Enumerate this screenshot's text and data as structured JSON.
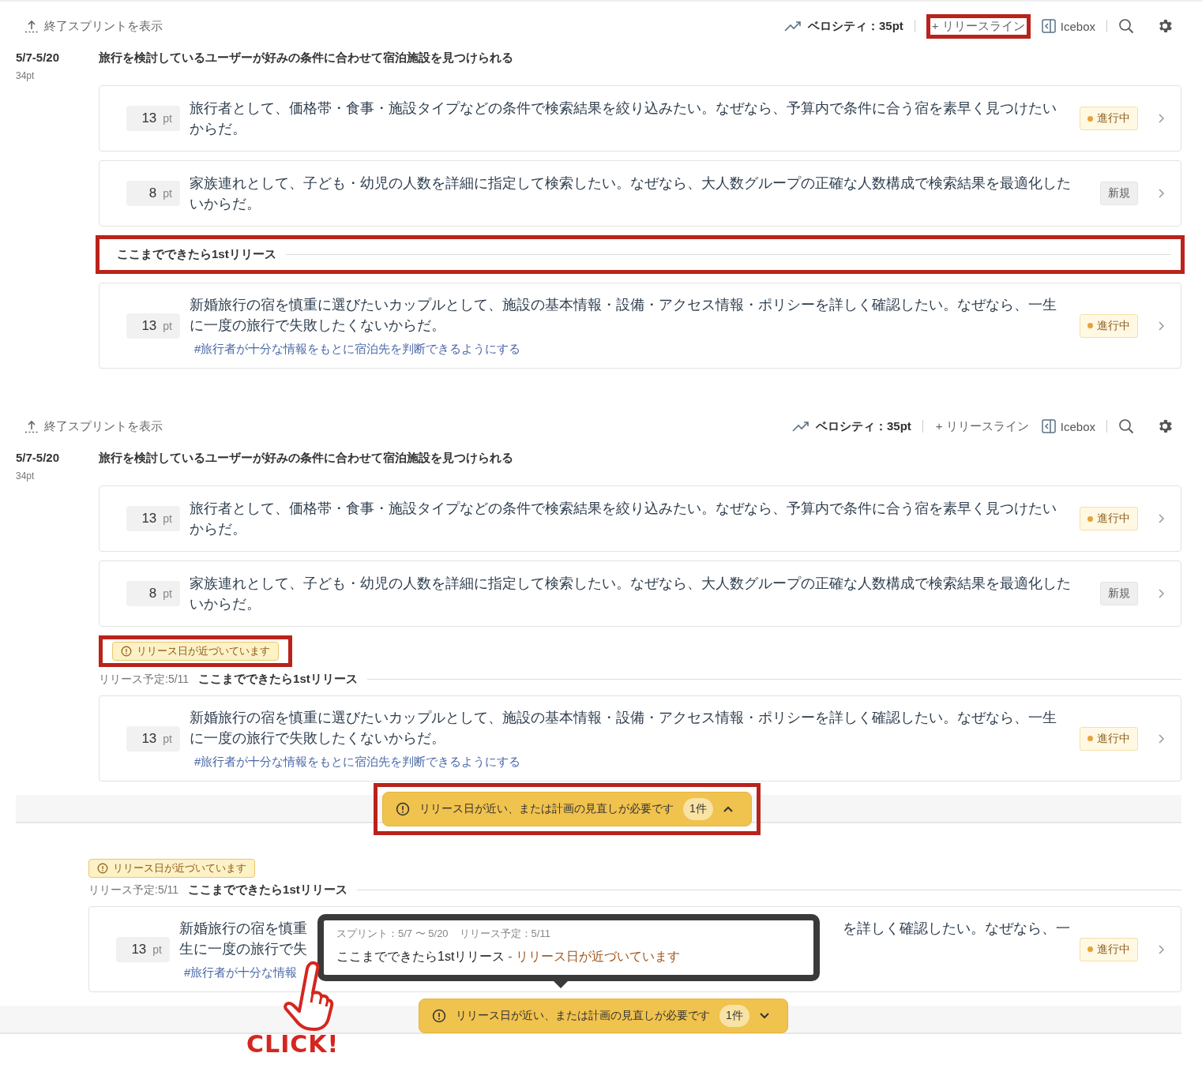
{
  "panels": [
    {
      "header": {
        "show_ended": "終了スプリントを表示",
        "velocity": "ベロシティ：35pt",
        "release_line": {
          "label": "+ リリースライン",
          "highlighted": true
        },
        "icebox": "Icebox"
      },
      "sprint": {
        "dates": "5/7-5/20",
        "points": "34pt",
        "title": "旅行を検討しているユーザーが好みの条件に合わせて宿泊施設を見つけられる"
      },
      "items": [
        {
          "kind": "story",
          "points": "13",
          "unit": "pt",
          "text": "旅行者として、価格帯・食事・施設タイプなどの条件で検索結果を絞り込みたい。なぜなら、予算内で条件に合う宿を素早く見つけたいからだ。",
          "status": {
            "label": "進行中",
            "kind": "in_progress"
          }
        },
        {
          "kind": "story",
          "points": "8",
          "unit": "pt",
          "text": "家族連れとして、子ども・幼児の人数を詳細に指定して検索したい。なぜなら、大人数グループの正確な人数構成で検索結果を最適化したいからだ。",
          "status": {
            "label": "新規",
            "kind": "new"
          }
        },
        {
          "kind": "release",
          "title": "ここまでできたら1stリリース",
          "highlighted": true
        },
        {
          "kind": "story",
          "points": "13",
          "unit": "pt",
          "text": "新婚旅行の宿を慎重に選びたいカップルとして、施設の基本情報・設備・アクセス情報・ポリシーを詳しく確認したい。なぜなら、一生に一度の旅行で失敗したくないからだ。",
          "tag": "#旅行者が十分な情報をもとに宿泊先を判断できるようにする",
          "status": {
            "label": "進行中",
            "kind": "in_progress"
          }
        }
      ]
    },
    {
      "header": {
        "show_ended": "終了スプリントを表示",
        "velocity": "ベロシティ：35pt",
        "release_line": {
          "label": "+ リリースライン",
          "highlighted": false
        },
        "icebox": "Icebox"
      },
      "sprint": {
        "dates": "5/7-5/20",
        "points": "34pt",
        "title": "旅行を検討しているユーザーが好みの条件に合わせて宿泊施設を見つけられる"
      },
      "items": [
        {
          "kind": "story",
          "points": "13",
          "unit": "pt",
          "text": "旅行者として、価格帯・食事・施設タイプなどの条件で検索結果を絞り込みたい。なぜなら、予算内で条件に合う宿を素早く見つけたいからだ。",
          "status": {
            "label": "進行中",
            "kind": "in_progress"
          }
        },
        {
          "kind": "story",
          "points": "8",
          "unit": "pt",
          "text": "家族連れとして、子ども・幼児の人数を詳細に指定して検索したい。なぜなら、大人数グループの正確な人数構成で検索結果を最適化したいからだ。",
          "status": {
            "label": "新規",
            "kind": "new"
          }
        },
        {
          "kind": "release",
          "warning": {
            "label": "リリース日が近づいています",
            "highlighted": true
          },
          "scheduled": "リリース予定:5/11",
          "title": "ここまでできたら1stリリース",
          "highlighted": false
        },
        {
          "kind": "story",
          "points": "13",
          "unit": "pt",
          "text": "新婚旅行の宿を慎重に選びたいカップルとして、施設の基本情報・設備・アクセス情報・ポリシーを詳しく確認したい。なぜなら、一生に一度の旅行で失敗したくないからだ。",
          "tag": "#旅行者が十分な情報をもとに宿泊先を判断できるようにする",
          "status": {
            "label": "進行中",
            "kind": "in_progress"
          }
        }
      ],
      "alert": {
        "message": "リリース日が近い、または計画の見直しが必要です",
        "count": "1件",
        "expanded": false,
        "highlighted": true
      }
    },
    {
      "items": [
        {
          "kind": "release",
          "warning": {
            "label": "リリース日が近づいています",
            "highlighted": false
          },
          "scheduled": "リリース予定:5/11",
          "title": "ここまでできたら1stリリース",
          "highlighted": false
        },
        {
          "kind": "story_partial",
          "points": "13",
          "unit": "pt",
          "text_parts": [
            "新婚旅行の宿を慎重",
            "を詳しく確認したい。なぜなら、一",
            "生に一度の旅行で失"
          ],
          "tag": "#旅行者が十分な情報",
          "status": {
            "label": "進行中",
            "kind": "in_progress"
          }
        }
      ],
      "alert": {
        "message": "リリース日が近い、または計画の見直しが必要です",
        "count": "1件",
        "expanded": true,
        "highlighted": false
      },
      "tooltip": {
        "sprint": "スプリント：5/7 〜 5/20",
        "scheduled": "リリース予定：5/11",
        "title": "ここまでできたら1stリリース",
        "warning": "- リリース日が近づいています"
      },
      "annotation": {
        "label": "CLICK!"
      }
    }
  ]
}
